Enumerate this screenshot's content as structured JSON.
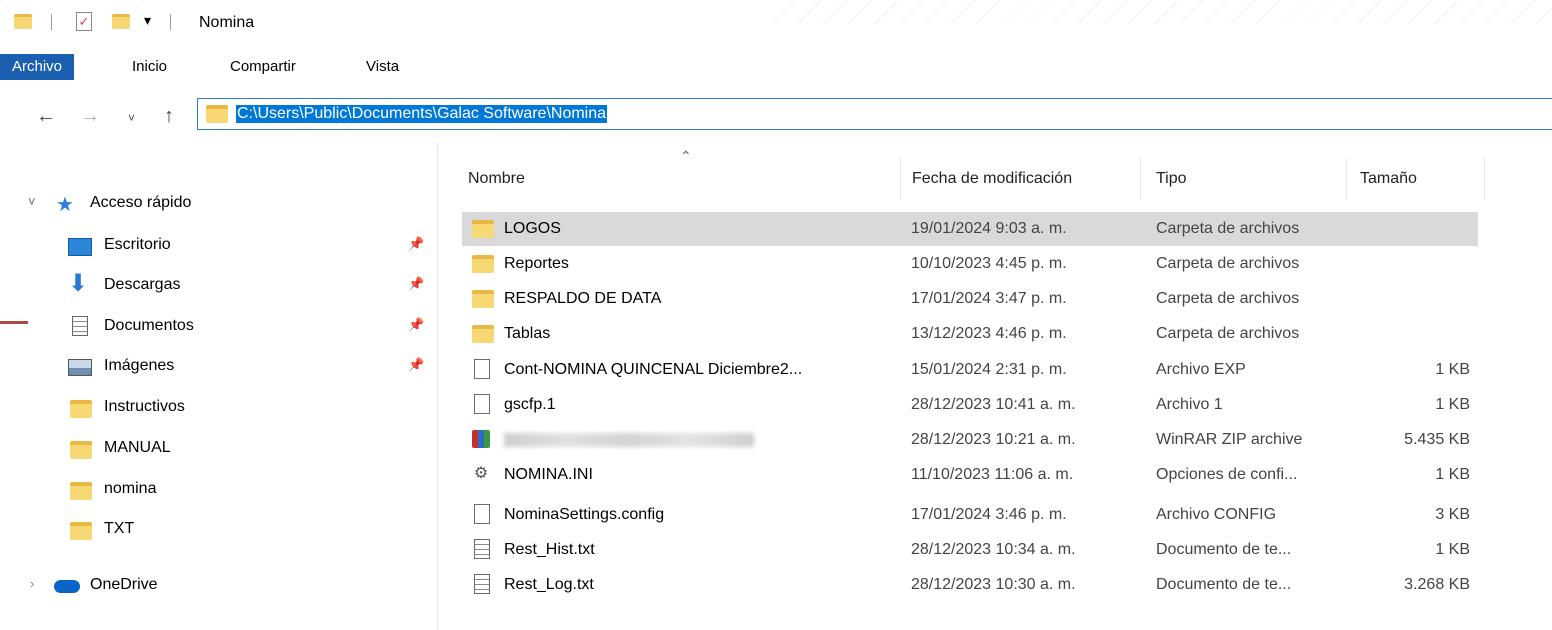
{
  "window": {
    "title": "Nomina"
  },
  "ribbon": {
    "tabs": [
      {
        "label": "Archivo",
        "active": true
      },
      {
        "label": "Inicio",
        "active": false
      },
      {
        "label": "Compartir",
        "active": false
      },
      {
        "label": "Vista",
        "active": false
      }
    ]
  },
  "address": {
    "path": "C:\\Users\\Public\\Documents\\Galac Software\\Nomina"
  },
  "nav": {
    "quick_access": "Acceso rápido",
    "items": [
      {
        "label": "Escritorio",
        "icon": "desktop-icon",
        "pinned": true
      },
      {
        "label": "Descargas",
        "icon": "download-icon",
        "pinned": true
      },
      {
        "label": "Documentos",
        "icon": "document-icon",
        "pinned": true
      },
      {
        "label": "Imágenes",
        "icon": "pictures-icon",
        "pinned": true
      },
      {
        "label": "Instructivos",
        "icon": "folder-icon",
        "pinned": false
      },
      {
        "label": "MANUAL",
        "icon": "folder-icon",
        "pinned": false
      },
      {
        "label": "nomina",
        "icon": "folder-icon",
        "pinned": false
      },
      {
        "label": "TXT",
        "icon": "folder-icon",
        "pinned": false
      }
    ],
    "onedrive": "OneDrive"
  },
  "columns": {
    "name": "Nombre",
    "date": "Fecha de modificación",
    "type": "Tipo",
    "size": "Tamaño"
  },
  "files": [
    {
      "name": "LOGOS",
      "date": "19/01/2024 9:03 a. m.",
      "type": "Carpeta de archivos",
      "size": "",
      "icon": "folder-icon",
      "selected": true
    },
    {
      "name": "Reportes",
      "date": "10/10/2023 4:45 p. m.",
      "type": "Carpeta de archivos",
      "size": "",
      "icon": "folder-icon"
    },
    {
      "name": "RESPALDO DE DATA",
      "date": "17/01/2024 3:47 p. m.",
      "type": "Carpeta de archivos",
      "size": "",
      "icon": "folder-icon"
    },
    {
      "name": "Tablas",
      "date": "13/12/2023 4:46 p. m.",
      "type": "Carpeta de archivos",
      "size": "",
      "icon": "folder-icon"
    },
    {
      "name": "Cont-NOMINA QUINCENAL Diciembre2...",
      "date": "15/01/2024 2:31 p. m.",
      "type": "Archivo EXP",
      "size": "1 KB",
      "icon": "file-icon"
    },
    {
      "name": "gscfp.1",
      "date": "28/12/2023 10:41 a. m.",
      "type": "Archivo 1",
      "size": "1 KB",
      "icon": "file-icon"
    },
    {
      "name": "",
      "date": "28/12/2023 10:21 a. m.",
      "type": "WinRAR ZIP archive",
      "size": "5.435 KB",
      "icon": "winrar-icon",
      "blurred": true
    },
    {
      "name": "NOMINA.INI",
      "date": "11/10/2023 11:06 a. m.",
      "type": "Opciones de confi...",
      "size": "1 KB",
      "icon": "settings-file-icon"
    },
    {
      "name": "NominaSettings.config",
      "date": "17/01/2024 3:46 p. m.",
      "type": "Archivo CONFIG",
      "size": "3 KB",
      "icon": "file-icon"
    },
    {
      "name": "Rest_Hist.txt",
      "date": "28/12/2023 10:34 a. m.",
      "type": "Documento de te...",
      "size": "1 KB",
      "icon": "text-file-icon"
    },
    {
      "name": "Rest_Log.txt",
      "date": "28/12/2023 10:30 a. m.",
      "type": "Documento de te...",
      "size": "3.268 KB",
      "icon": "text-file-icon"
    }
  ]
}
